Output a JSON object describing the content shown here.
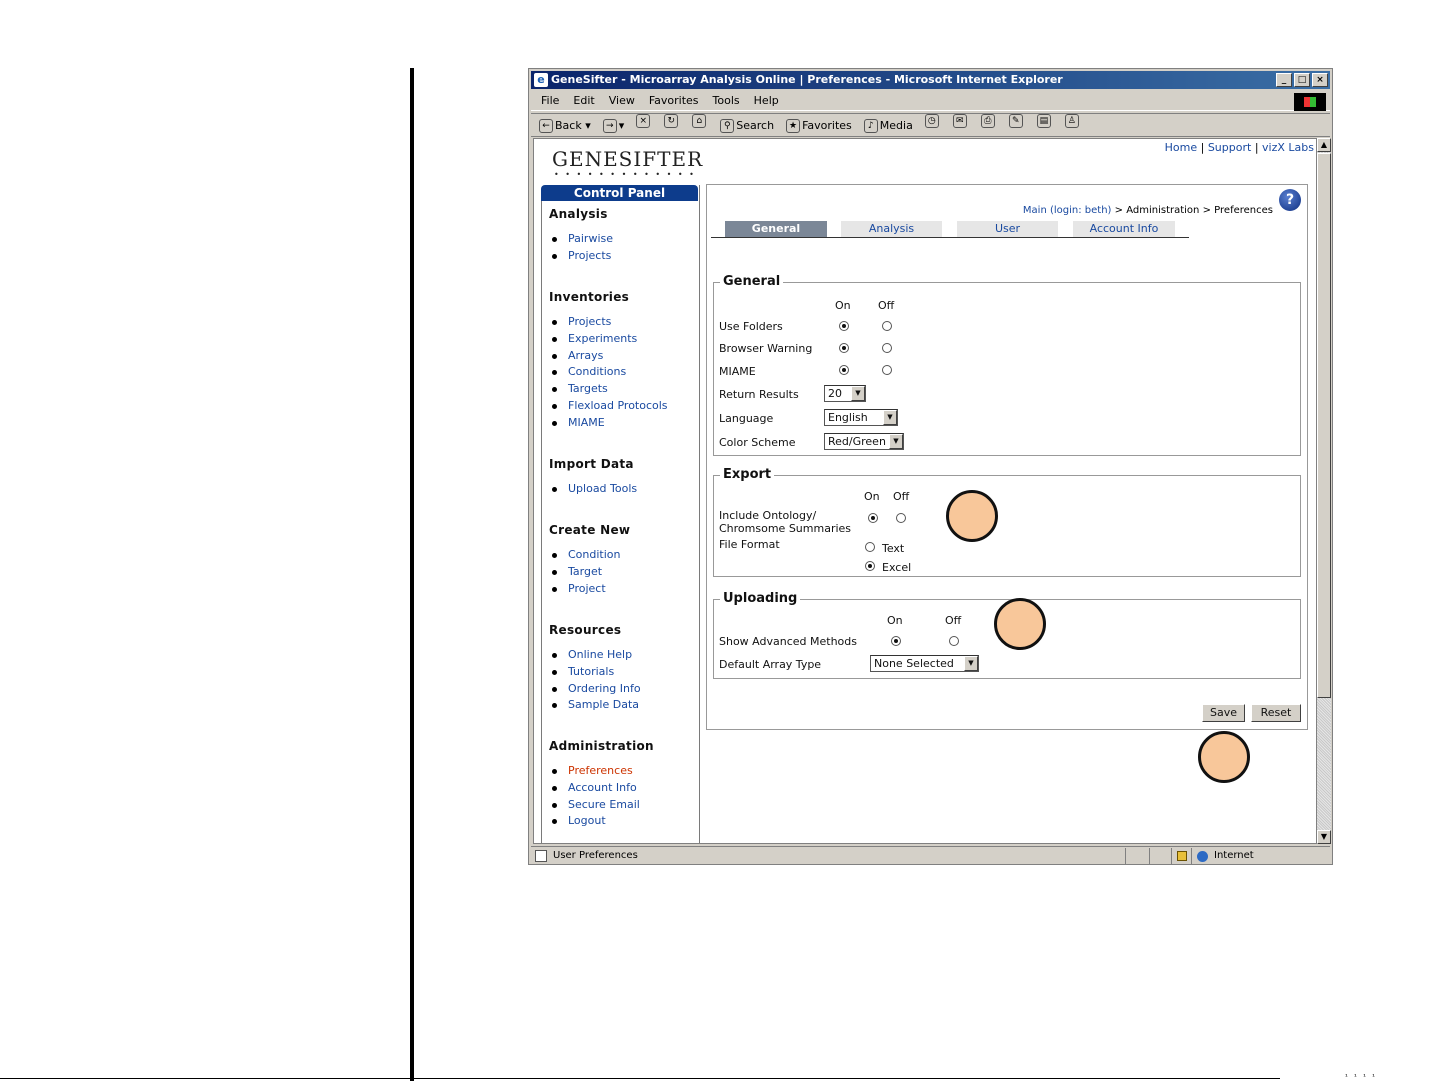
{
  "window": {
    "title": "GeneSifter - Microarray Analysis Online | Preferences - Microsoft Internet Explorer",
    "menu": [
      "File",
      "Edit",
      "View",
      "Favorites",
      "Tools",
      "Help"
    ],
    "toolbar": {
      "back": "Back",
      "search": "Search",
      "favorites": "Favorites",
      "media": "Media"
    },
    "status": "User Preferences",
    "zone": "Internet"
  },
  "header": {
    "logo": "GENESIFTER",
    "links": [
      "Home",
      "Support",
      "vizX Labs"
    ],
    "link_sep": "|"
  },
  "sidebar": {
    "title": "Control Panel",
    "sections": [
      {
        "title": "Analysis",
        "items": [
          "Pairwise",
          "Projects"
        ]
      },
      {
        "title": "Inventories",
        "items": [
          "Projects",
          "Experiments",
          "Arrays",
          "Conditions",
          "Targets",
          "Flexload Protocols",
          "MIAME"
        ]
      },
      {
        "title": "Import Data",
        "items": [
          "Upload Tools"
        ]
      },
      {
        "title": "Create New",
        "items": [
          "Condition",
          "Target",
          "Project"
        ]
      },
      {
        "title": "Resources",
        "items": [
          "Online Help",
          "Tutorials",
          "Ordering Info",
          "Sample Data"
        ]
      },
      {
        "title": "Administration",
        "items": [
          "Preferences",
          "Account Info",
          "Secure Email",
          "Logout"
        ]
      }
    ]
  },
  "breadcrumb": {
    "main": "Main (login: beth)",
    "sep": ">",
    "admin": "Administration",
    "current": "Preferences"
  },
  "tabs": [
    "General",
    "Analysis",
    "User",
    "Account Info"
  ],
  "general": {
    "legend": "General",
    "on": "On",
    "off": "Off",
    "use_folders": "Use Folders",
    "browser_warning": "Browser Warning",
    "miame": "MIAME",
    "return_results": "Return Results",
    "return_results_value": "20",
    "language": "Language",
    "language_value": "English",
    "color_scheme": "Color Scheme",
    "color_scheme_value": "Red/Green"
  },
  "export": {
    "legend": "Export",
    "on": "On",
    "off": "Off",
    "include_line1": "Include Ontology/",
    "include_line2": "Chromsome Summaries",
    "file_format": "File Format",
    "text": "Text",
    "excel": "Excel"
  },
  "uploading": {
    "legend": "Uploading",
    "on": "On",
    "off": "Off",
    "show_advanced": "Show Advanced Methods",
    "default_array": "Default Array Type",
    "default_array_value": "None Selected"
  },
  "buttons": {
    "save": "Save",
    "reset": "Reset"
  },
  "footer_marks": "¹ ¹ ¹ ¹"
}
